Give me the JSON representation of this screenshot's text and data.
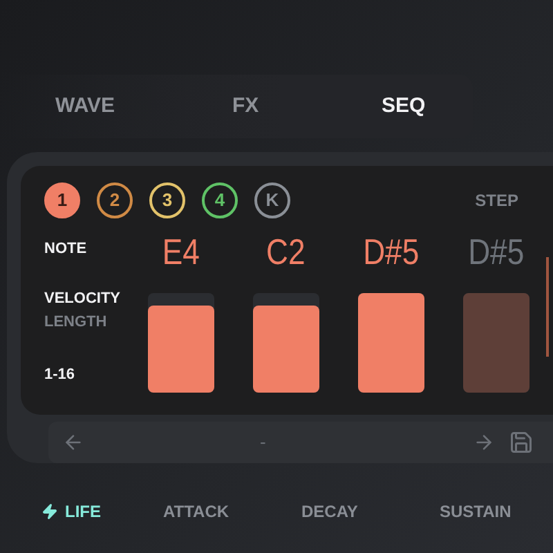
{
  "tabs": [
    {
      "label": "WAVE",
      "selected": false
    },
    {
      "label": "FX",
      "selected": false
    },
    {
      "label": "SEQ",
      "selected": true
    }
  ],
  "channels": [
    {
      "label": "1",
      "color": "#f07f66",
      "selected": true
    },
    {
      "label": "2",
      "color": "#d08a45",
      "selected": false
    },
    {
      "label": "3",
      "color": "#e2c26a",
      "selected": false
    },
    {
      "label": "4",
      "color": "#5fc266",
      "selected": false
    },
    {
      "label": "K",
      "color": "#8a8f96",
      "selected": false
    }
  ],
  "step_label": "STEP",
  "row_labels": {
    "note": "NOTE",
    "velocity": "VELOCITY",
    "length": "LENGTH",
    "range": "1-16"
  },
  "steps": [
    {
      "note": "E4",
      "active": true,
      "level": 0.87
    },
    {
      "note": "C2",
      "active": true,
      "level": 0.87
    },
    {
      "note": "D#5",
      "active": true,
      "level": 1
    },
    {
      "note": "D#5",
      "active": false,
      "level": 1
    }
  ],
  "pager": {
    "value": "-"
  },
  "bottom_tabs": [
    {
      "label": "LIFE",
      "selected": true
    },
    {
      "label": "ATTACK",
      "selected": false
    },
    {
      "label": "DECAY",
      "selected": false
    },
    {
      "label": "SUSTAIN",
      "selected": false
    }
  ]
}
